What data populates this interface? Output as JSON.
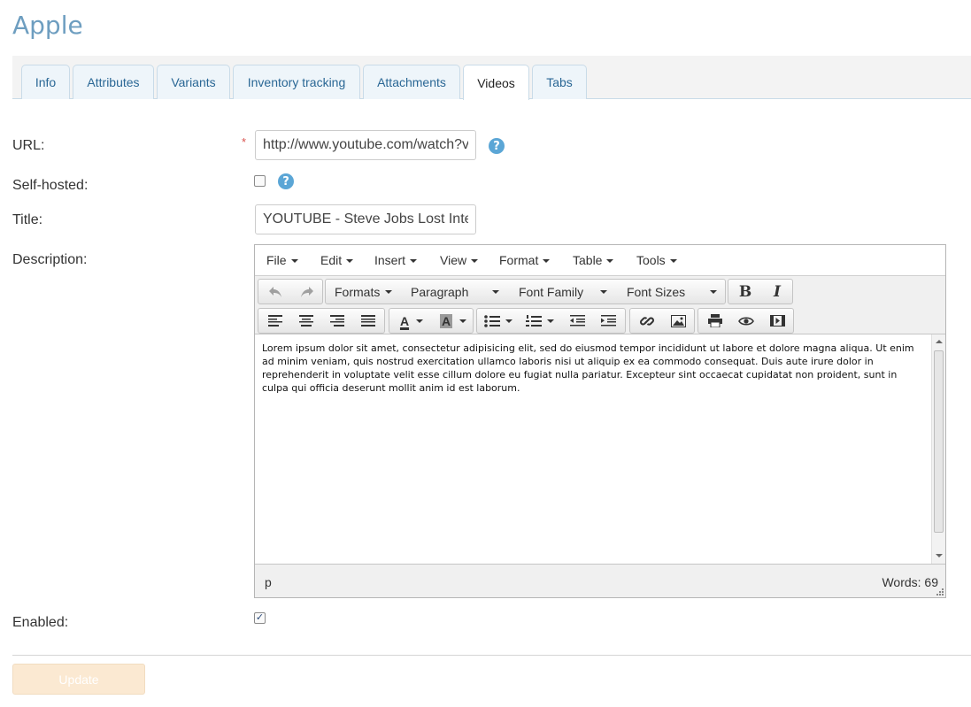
{
  "page": {
    "title": "Apple"
  },
  "tabs": [
    {
      "label": "Info"
    },
    {
      "label": "Attributes"
    },
    {
      "label": "Variants"
    },
    {
      "label": "Inventory tracking"
    },
    {
      "label": "Attachments"
    },
    {
      "label": "Videos",
      "active": true
    },
    {
      "label": "Tabs"
    }
  ],
  "form": {
    "url_label": "URL:",
    "url_required_mark": "*",
    "url_value": "http://www.youtube.com/watch?v",
    "self_hosted_label": "Self-hosted:",
    "self_hosted_checked": false,
    "title_label": "Title:",
    "title_value": "YOUTUBE - Steve Jobs Lost Inte",
    "description_label": "Description:",
    "enabled_label": "Enabled:",
    "enabled_checked": true,
    "help_glyph": "?",
    "check_glyph": "✓"
  },
  "editor": {
    "menu": [
      "File",
      "Edit",
      "Insert",
      "View",
      "Format",
      "Table",
      "Tools"
    ],
    "formats_label": "Formats",
    "paragraph_label": "Paragraph",
    "font_family_label": "Font Family",
    "font_sizes_label": "Font Sizes",
    "bold_glyph": "B",
    "italic_glyph": "I",
    "text_color_glyph": "A",
    "bg_color_glyph": "A",
    "content": "Lorem ipsum dolor sit amet, consectetur adipisicing elit, sed do eiusmod tempor incididunt ut labore et dolore magna aliqua. Ut enim ad minim veniam, quis nostrud exercitation ullamco laboris nisi ut aliquip ex ea commodo consequat. Duis aute irure dolor in reprehenderit in voluptate velit esse cillum dolore eu fugiat nulla pariatur. Excepteur sint occaecat cupidatat non proident, sunt in culpa qui officia deserunt mollit anim id est laborum.",
    "path": "p",
    "word_count": "Words: 69"
  },
  "actions": {
    "update_label": "Update"
  },
  "colors": {
    "title": "#6e9ec0",
    "tab_text": "#2a6795",
    "help": "#5ba6d6",
    "update_bg": "#fbe9d2"
  }
}
